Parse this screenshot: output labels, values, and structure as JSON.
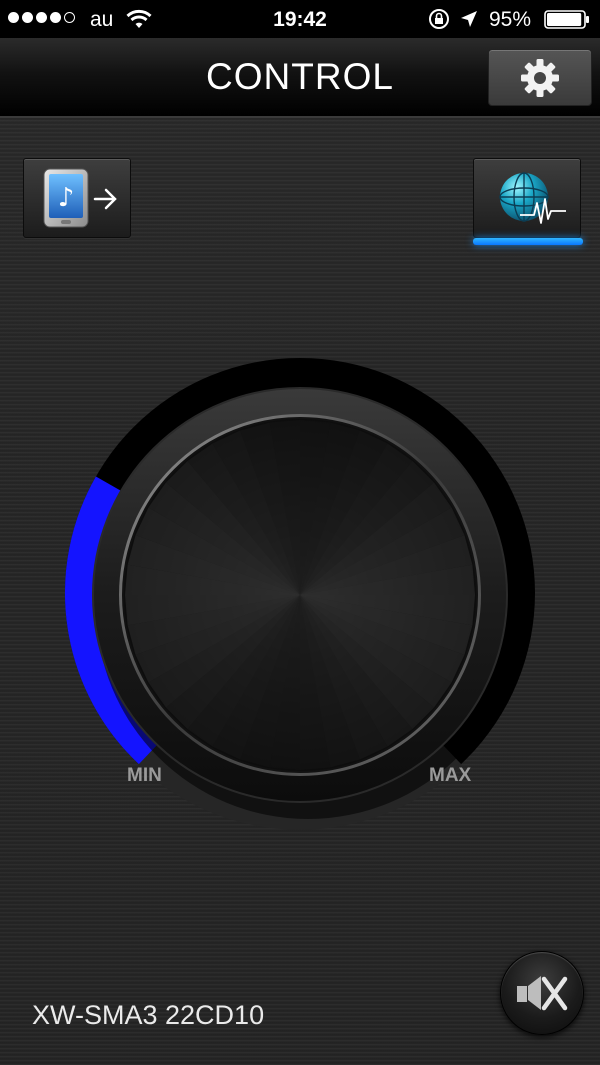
{
  "status_bar": {
    "carrier": "au",
    "time": "19:42",
    "battery_percent": "95%",
    "battery_level": 0.95,
    "signal_bars": 4,
    "signal_max": 5
  },
  "nav": {
    "title": "CONTROL",
    "settings_icon": "gear-icon"
  },
  "buttons": {
    "source_icon": "phone-music-arrow-icon",
    "network_icon": "globe-waveform-icon",
    "network_active": true
  },
  "volume": {
    "min_label": "MIN",
    "max_label": "MAX",
    "level": 0.28,
    "accent_color": "#1414ff"
  },
  "mute": {
    "icon": "speaker-muted-icon"
  },
  "device": {
    "name": "XW-SMA3 22CD10"
  }
}
